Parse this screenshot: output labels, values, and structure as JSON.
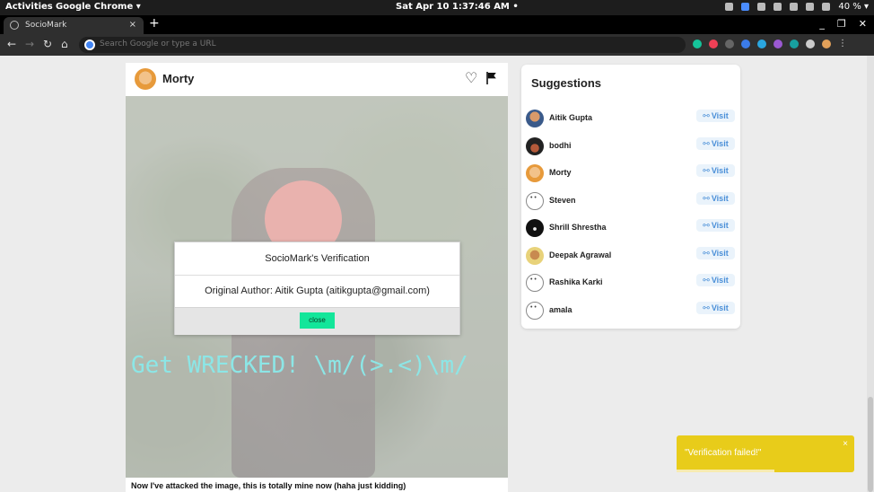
{
  "os_bar": {
    "activities": "Activities",
    "app_name": "Google Chrome ▾",
    "clock": "Sat Apr 10  1:37:46 AM  •",
    "battery": "40 % ▾"
  },
  "browser": {
    "tab_title": "SocioMark",
    "tab_close": "×",
    "new_tab": "+",
    "omnibox_placeholder": "Search Google or type a URL"
  },
  "post": {
    "author": "Morty",
    "image_overlay_text": "Get WRECKED! \\m/(>.<)\\m/",
    "caption": "Now I've attacked the image, this is totally mine now (haha just kidding)"
  },
  "modal": {
    "title": "SocioMark's Verification",
    "body": "Original Author: Aitik Gupta (aitikgupta@gmail.com)",
    "close_label": "close"
  },
  "suggestions": {
    "title": "Suggestions",
    "visit_label": "Visit",
    "users": [
      {
        "name": "Aitik Gupta"
      },
      {
        "name": "bodhi"
      },
      {
        "name": "Morty"
      },
      {
        "name": "Steven"
      },
      {
        "name": "Shrill Shrestha"
      },
      {
        "name": "Deepak Agrawal"
      },
      {
        "name": "Rashika Karki"
      },
      {
        "name": "amala"
      }
    ]
  },
  "toast": {
    "message": "\"Verification failed!\"",
    "close": "×",
    "progress": 0.55
  },
  "colors": {
    "toast_bg": "#e8cc1a",
    "close_button": "#13e69a",
    "visit_text": "#4a8fd8",
    "overlay_text": "#8ce6e6"
  }
}
